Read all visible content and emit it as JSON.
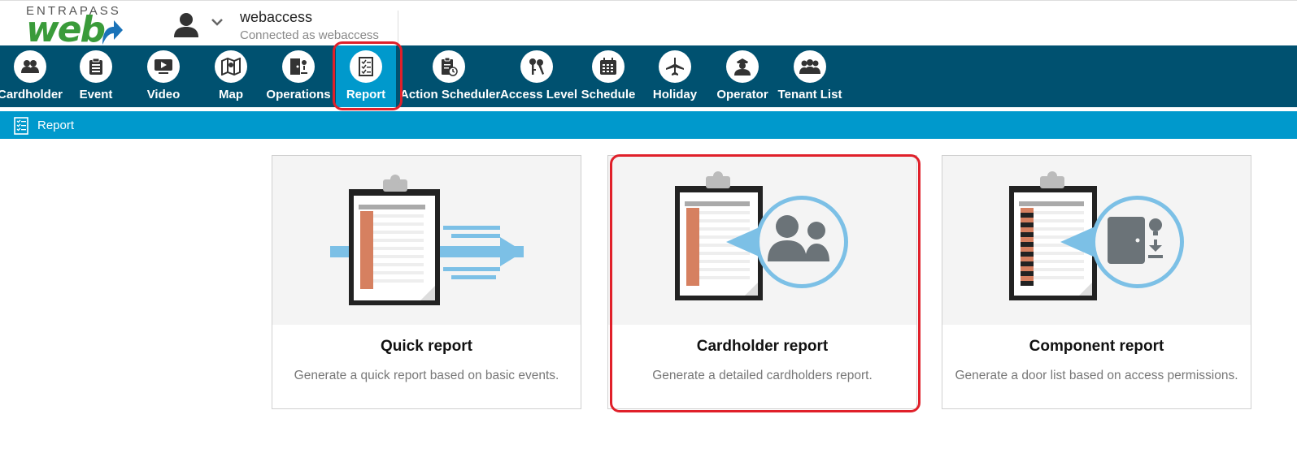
{
  "header": {
    "logo_top": "ENTRAPASS",
    "logo_main": "web",
    "username": "webaccess",
    "connected_label": "Connected as  webaccess"
  },
  "nav": {
    "items": [
      {
        "label": "Cardholder",
        "icon": "cardholder-icon"
      },
      {
        "label": "Event",
        "icon": "clipboard-icon"
      },
      {
        "label": "Video",
        "icon": "video-icon"
      },
      {
        "label": "Map",
        "icon": "map-icon"
      },
      {
        "label": "Operations",
        "icon": "operations-icon"
      },
      {
        "label": "Report",
        "icon": "report-icon",
        "active": true
      },
      {
        "label": "Action Scheduler",
        "icon": "action-scheduler-icon"
      },
      {
        "label": "Access Level",
        "icon": "access-level-icon"
      },
      {
        "label": "Schedule",
        "icon": "calendar-icon"
      },
      {
        "label": "Holiday",
        "icon": "airplane-icon"
      },
      {
        "label": "Operator",
        "icon": "operator-icon"
      },
      {
        "label": "Tenant List",
        "icon": "tenant-list-icon"
      }
    ]
  },
  "breadcrumb": {
    "label": "Report",
    "icon": "report-icon"
  },
  "cards": [
    {
      "title": "Quick report",
      "description": "Generate a quick report based on basic events."
    },
    {
      "title": "Cardholder report",
      "description": "Generate a detailed cardholders report."
    },
    {
      "title": "Component report",
      "description": "Generate a door list based on access permissions."
    }
  ],
  "colors": {
    "nav_bg": "#005170",
    "accent": "#0099cc",
    "highlight": "#e0202a",
    "logo_green": "#3a9b3a"
  }
}
